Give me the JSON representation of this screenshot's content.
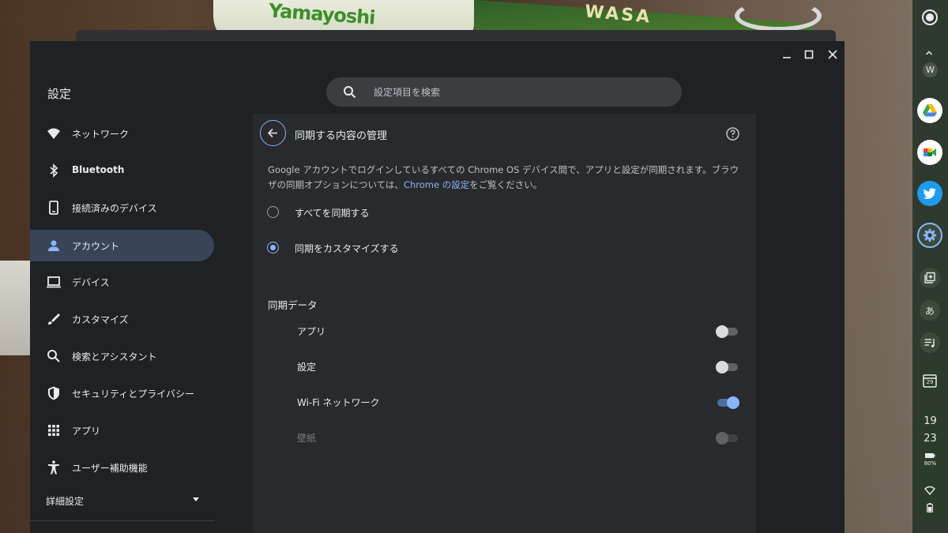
{
  "window": {
    "controls": {
      "minimize": "—",
      "maximize": "☐",
      "close": "✕"
    }
  },
  "header": {
    "title": "設定",
    "search_placeholder": "設定項目を検索"
  },
  "sidebar": {
    "items": [
      {
        "label": "ネットワーク",
        "icon": "wifi-icon"
      },
      {
        "label": "Bluetooth",
        "icon": "bluetooth-icon"
      },
      {
        "label": "接続済みのデバイス",
        "icon": "phone-icon"
      },
      {
        "label": "アカウント",
        "icon": "person-icon",
        "active": true
      },
      {
        "label": "デバイス",
        "icon": "laptop-icon"
      },
      {
        "label": "カスタマイズ",
        "icon": "brush-icon"
      },
      {
        "label": "検索とアシスタント",
        "icon": "search-icon"
      },
      {
        "label": "セキュリティとプライバシー",
        "icon": "shield-icon"
      },
      {
        "label": "アプリ",
        "icon": "apps-grid-icon"
      },
      {
        "label": "ユーザー補助機能",
        "icon": "accessibility-icon"
      }
    ],
    "advanced_label": "詳細設定"
  },
  "main": {
    "title": "同期する内容の管理",
    "description_pre": "Google アカウントでログインしているすべての Chrome OS デバイス間で、アプリと設定が同期されます。ブラウザの同期オプションについては、",
    "description_link": "Chrome の設定",
    "description_post": "をご覧ください。",
    "radios": [
      {
        "label": "すべてを同期する",
        "checked": false
      },
      {
        "label": "同期をカスタマイズする",
        "checked": true
      }
    ],
    "section_title": "同期データ",
    "sync_items": [
      {
        "label": "アプリ",
        "on": false,
        "disabled": false
      },
      {
        "label": "設定",
        "on": false,
        "disabled": false
      },
      {
        "label": "Wi-Fi ネットワーク",
        "on": true,
        "disabled": false
      },
      {
        "label": "壁紙",
        "on": false,
        "disabled": true
      }
    ]
  },
  "shelf": {
    "collapsed_letter": "W",
    "apps": [
      "google-drive-icon",
      "google-meet-icon",
      "twitter-icon",
      "settings-gear-icon"
    ],
    "tray": [
      "screenshot-icon",
      "ime-icon",
      "media-icon",
      "calendar-icon"
    ],
    "ime_label": "あ",
    "calendar_day": "29",
    "time_hh": "19",
    "time_mm": "23",
    "battery_text": "80%",
    "colors": {
      "accent": "#8ab4f8",
      "shelf_bg": "#2f3a2e"
    }
  },
  "background": {
    "wrapper_brand": "Yamayoshi",
    "wrapper_text": "WASA"
  }
}
